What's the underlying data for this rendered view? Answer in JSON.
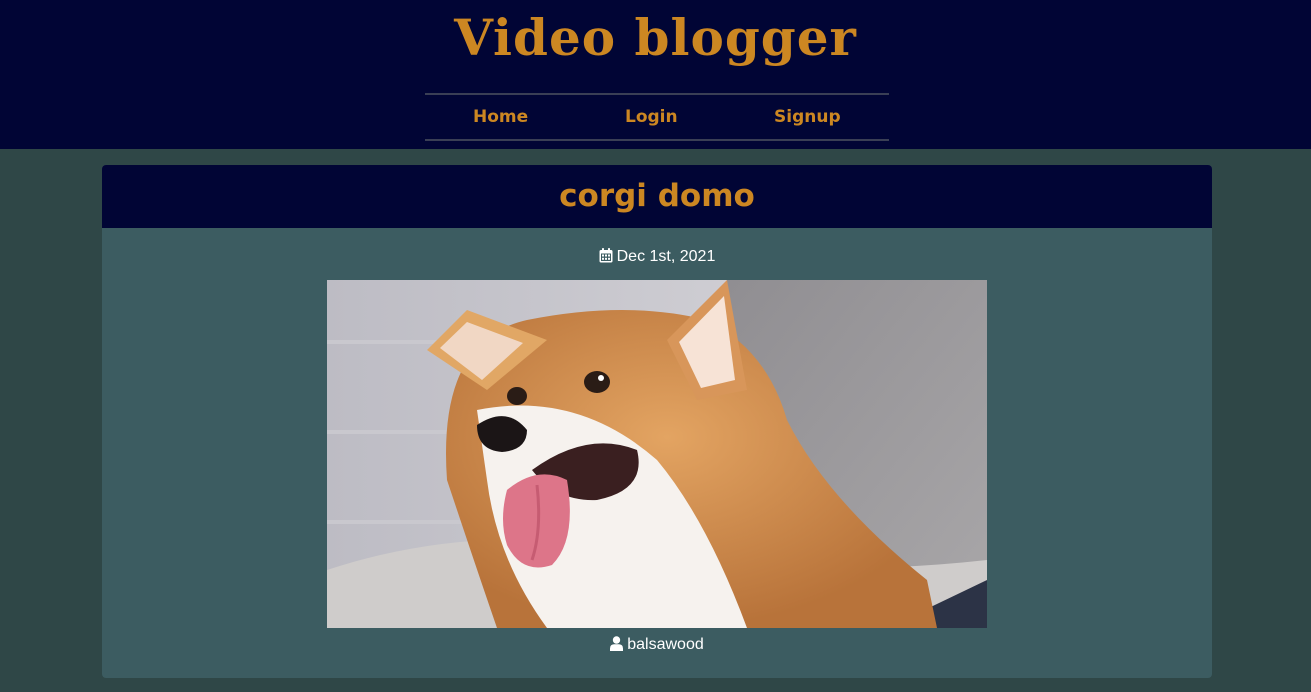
{
  "site": {
    "title": "Video blogger"
  },
  "nav": {
    "home": "Home",
    "login": "Login",
    "signup": "Signup"
  },
  "post": {
    "title": "corgi domo",
    "date": "Dec 1st, 2021",
    "author": "balsawood",
    "date_icon": "calendar-icon",
    "author_icon": "user-icon"
  },
  "colors": {
    "header_bg": "#010535",
    "accent": "#cc8722",
    "page_bg": "#2f4747",
    "card_body_bg": "#3c5c61"
  }
}
